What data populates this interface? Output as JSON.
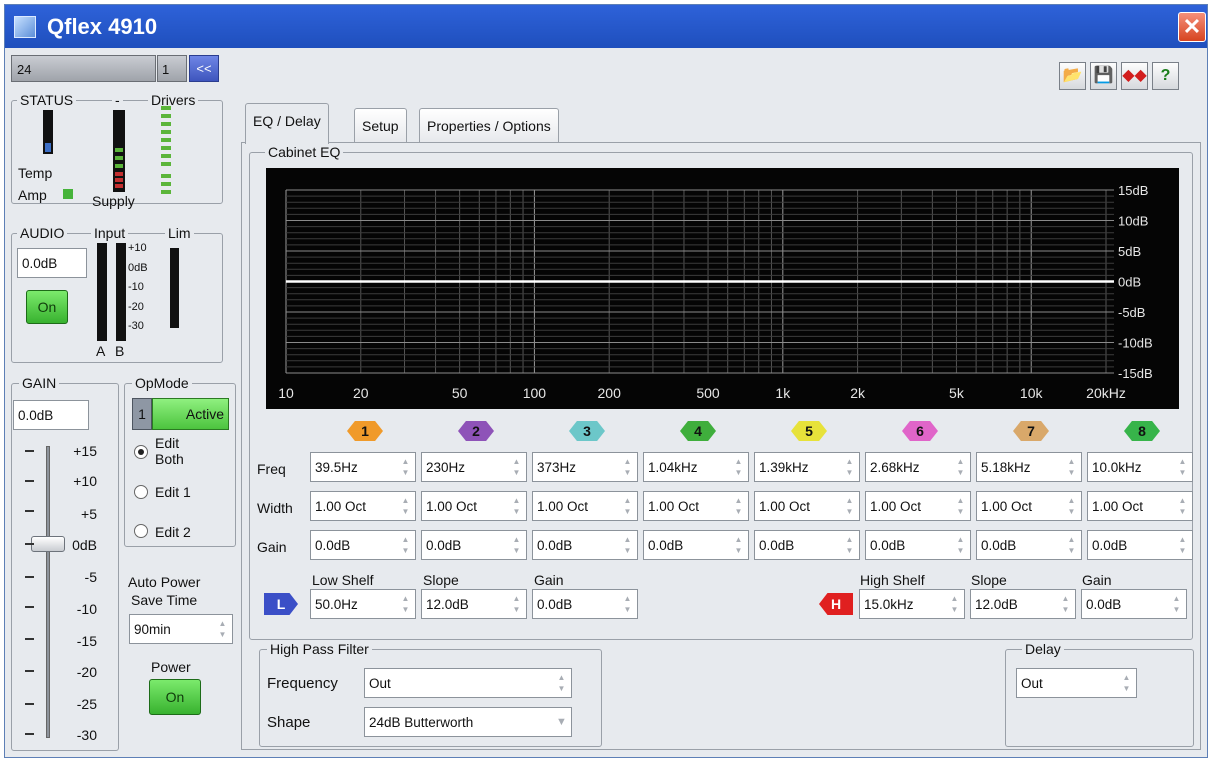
{
  "window": {
    "title": "Qflex 4910",
    "close_glyph": "✕"
  },
  "device": {
    "name": "24",
    "number": "1",
    "collapse_label": "<<"
  },
  "status": {
    "group_label": "STATUS",
    "drivers_label": "Drivers",
    "temp_label": "Temp",
    "amp_label": "Amp",
    "supply_label": "Supply",
    "separator": "-"
  },
  "audio": {
    "group_label": "AUDIO",
    "input_label": "Input",
    "lim_label": "Lim",
    "level_value": "0.0dB",
    "on_label": "On",
    "scale": [
      "+10",
      "0dB",
      "-10",
      "-20",
      "-30"
    ],
    "channel_a": "A",
    "channel_b": "B"
  },
  "gain": {
    "group_label": "GAIN",
    "value": "0.0dB",
    "scale": [
      "+15",
      "+10",
      "+5",
      "0dB",
      "-5",
      "-10",
      "-15",
      "-20",
      "-25",
      "-30"
    ]
  },
  "opmode": {
    "group_label": "OpMode",
    "number": "1",
    "status": "Active",
    "edit_both": "Edit Both",
    "edit_1": "Edit 1",
    "edit_2": "Edit 2"
  },
  "autopower": {
    "label_line1": "Auto Power",
    "label_line2": "Save Time",
    "value": "90min",
    "power_label": "Power",
    "power_on": "On"
  },
  "toolbar": {
    "icons": [
      "folder-open-icon",
      "save-icon",
      "link-icon",
      "help-icon"
    ]
  },
  "tabs": [
    {
      "label": "EQ / Delay"
    },
    {
      "label": "Setup"
    },
    {
      "label": "Properties / Options"
    }
  ],
  "cabinet_eq": {
    "group_label": "Cabinet EQ",
    "x_ticks": [
      "10",
      "20",
      "50",
      "100",
      "200",
      "500",
      "1k",
      "2k",
      "5k",
      "10k",
      "20kHz"
    ],
    "y_ticks": [
      "15dB",
      "10dB",
      "5dB",
      "0dB",
      "-5dB",
      "-10dB",
      "-15dB"
    ],
    "response_curve_db": 0
  },
  "bands": {
    "row_labels": {
      "freq": "Freq",
      "width": "Width",
      "gain": "Gain"
    },
    "items": [
      {
        "num": "1",
        "color": "#f09a2a",
        "freq": "39.5Hz",
        "width": "1.00 Oct",
        "gain": "0.0dB"
      },
      {
        "num": "2",
        "color": "#8e53b8",
        "freq": "230Hz",
        "width": "1.00 Oct",
        "gain": "0.0dB"
      },
      {
        "num": "3",
        "color": "#6cc7c9",
        "freq": "373Hz",
        "width": "1.00 Oct",
        "gain": "0.0dB"
      },
      {
        "num": "4",
        "color": "#3fae3c",
        "freq": "1.04kHz",
        "width": "1.00 Oct",
        "gain": "0.0dB"
      },
      {
        "num": "5",
        "color": "#e7e23a",
        "freq": "1.39kHz",
        "width": "1.00 Oct",
        "gain": "0.0dB"
      },
      {
        "num": "6",
        "color": "#e065c9",
        "freq": "2.68kHz",
        "width": "1.00 Oct",
        "gain": "0.0dB"
      },
      {
        "num": "7",
        "color": "#d9a86a",
        "freq": "5.18kHz",
        "width": "1.00 Oct",
        "gain": "0.0dB"
      },
      {
        "num": "8",
        "color": "#37b44a",
        "freq": "10.0kHz",
        "width": "1.00 Oct",
        "gain": "0.0dB"
      }
    ]
  },
  "low_shelf": {
    "icon_letter": "L",
    "color": "#3b4fc7",
    "label": "Low Shelf",
    "slope_label": "Slope",
    "gain_label": "Gain",
    "freq": "50.0Hz",
    "slope": "12.0dB",
    "gain": "0.0dB"
  },
  "high_shelf": {
    "icon_letter": "H",
    "color": "#e02020",
    "label": "High Shelf",
    "slope_label": "Slope",
    "gain_label": "Gain",
    "freq": "15.0kHz",
    "slope": "12.0dB",
    "gain": "0.0dB"
  },
  "hpf": {
    "group_label": "High Pass Filter",
    "frequency_label": "Frequency",
    "frequency": "Out",
    "shape_label": "Shape",
    "shape": "24dB Butterworth"
  },
  "delay": {
    "group_label": "Delay",
    "value": "Out"
  }
}
